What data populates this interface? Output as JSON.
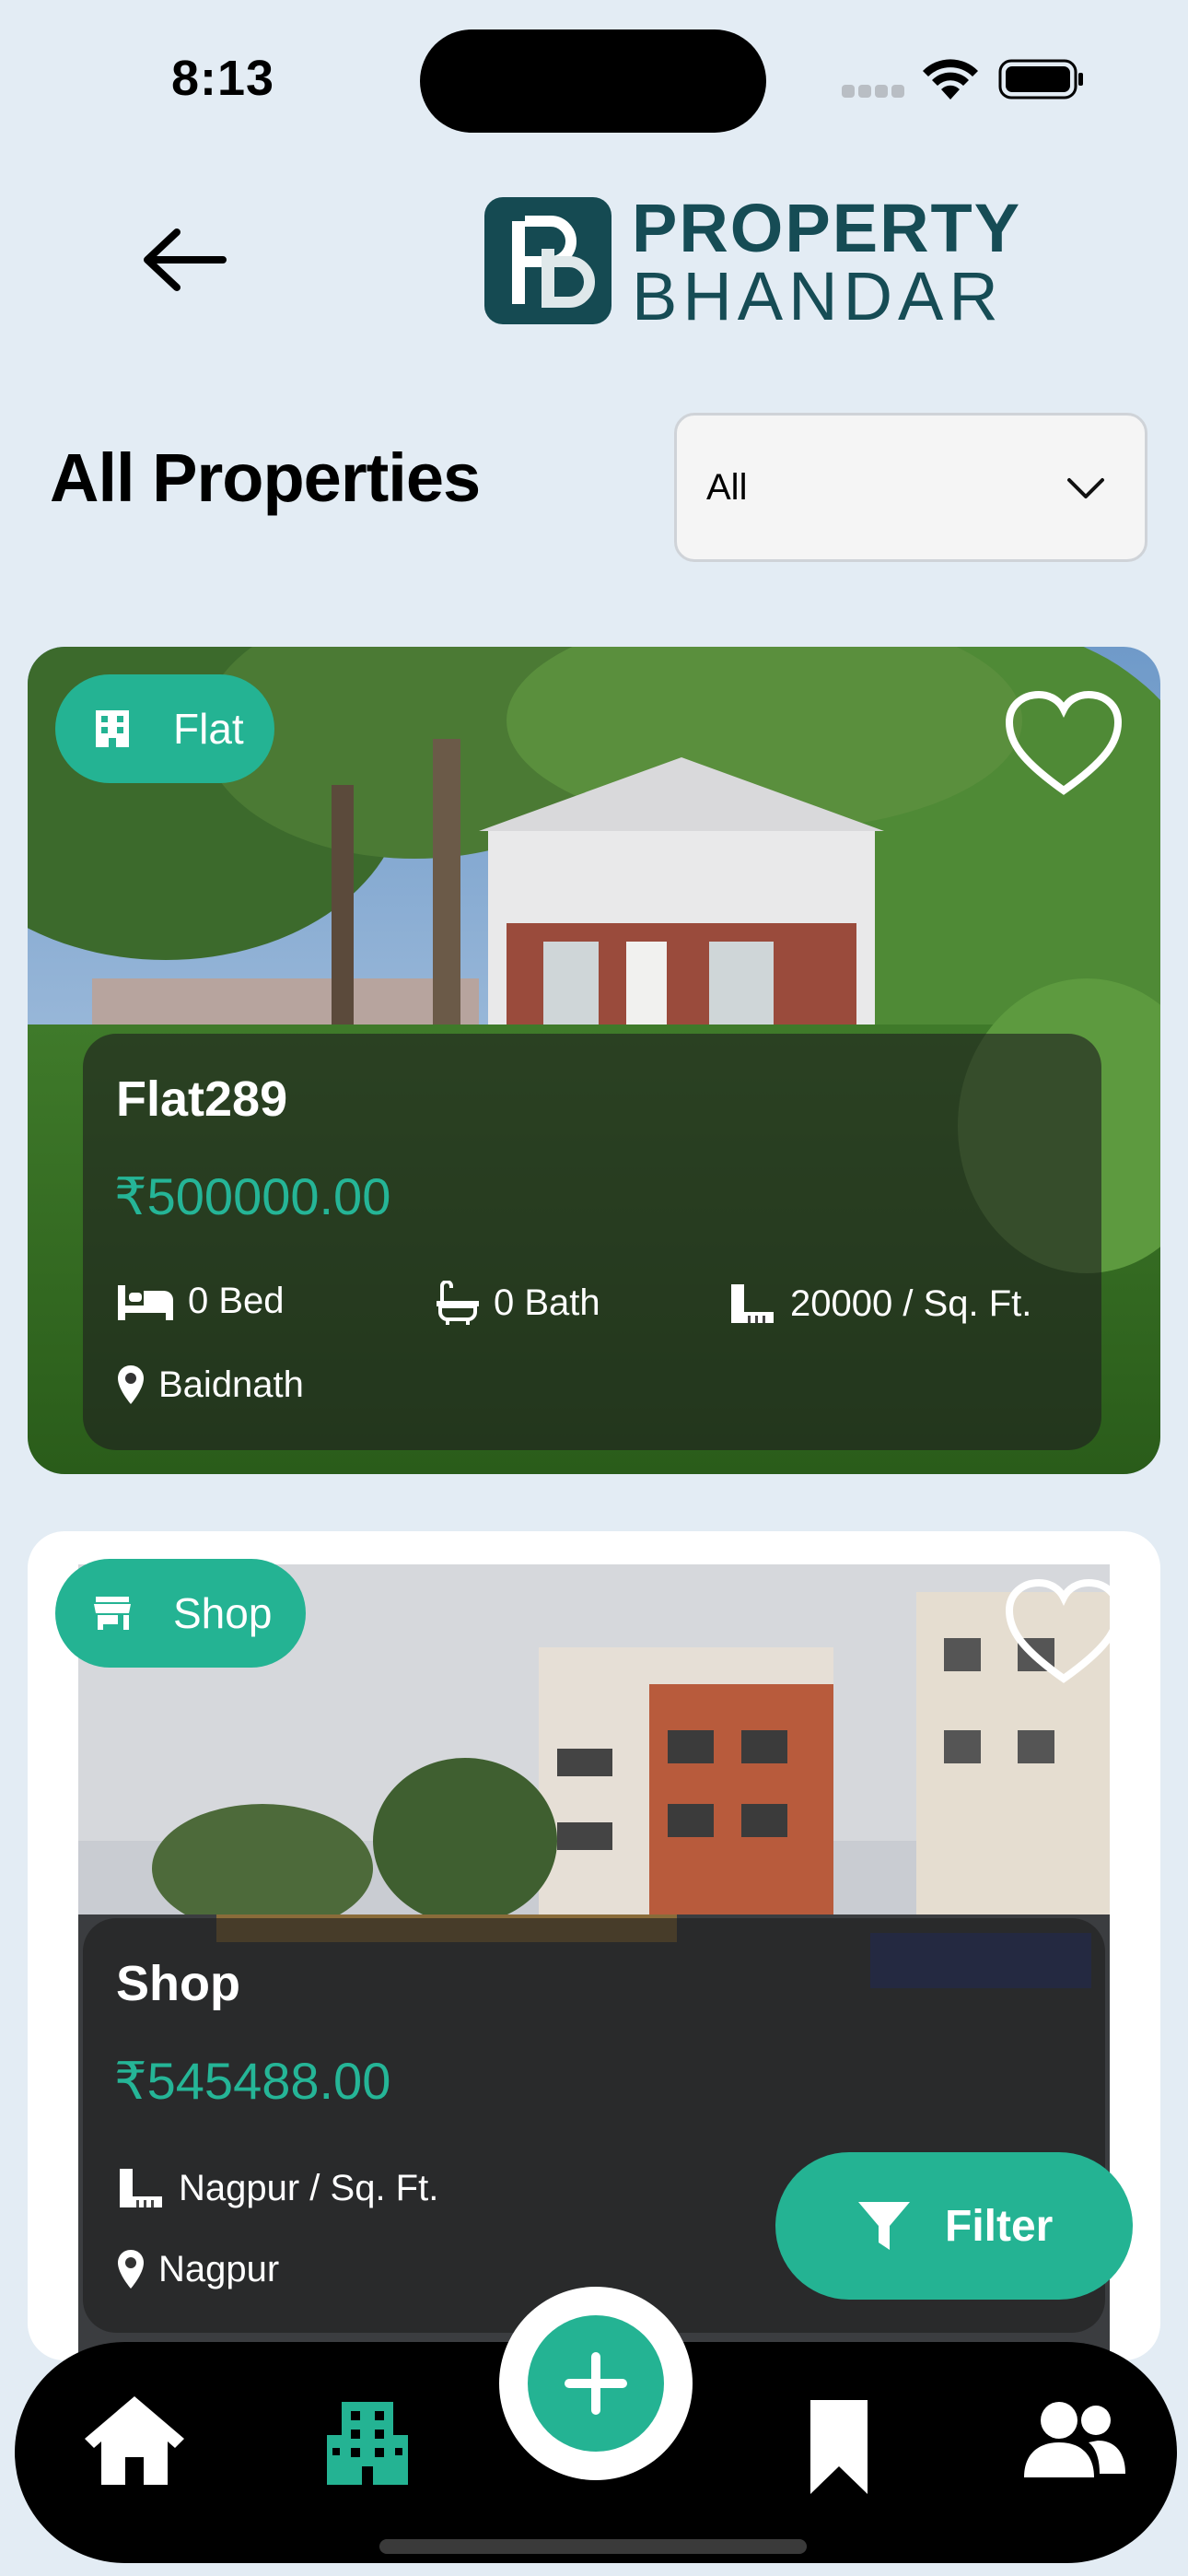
{
  "status_bar": {
    "time": "8:13"
  },
  "header": {
    "logo_line1": "PROPERTY",
    "logo_line2": "BHANDAR"
  },
  "page": {
    "title": "All Properties"
  },
  "type_filter": {
    "selected": "All"
  },
  "properties": [
    {
      "type": "Flat",
      "name": "Flat289",
      "price": "₹500000.00",
      "beds": "0 Bed",
      "baths": "0 Bath",
      "area": "20000 / Sq. Ft.",
      "location": "Baidnath"
    },
    {
      "type": "Shop",
      "name": "Shop",
      "price": "₹545488.00",
      "area": "Nagpur / Sq. Ft.",
      "location": "Nagpur"
    }
  ],
  "filter_button": {
    "label": "Filter"
  },
  "colors": {
    "accent": "#24b393",
    "background": "#e3ecf4",
    "logo": "#164c55"
  },
  "bottom_nav": {
    "items": [
      "home-icon",
      "buildings-icon",
      "add-icon",
      "bookmark-icon",
      "users-icon"
    ],
    "active": "buildings-icon"
  }
}
